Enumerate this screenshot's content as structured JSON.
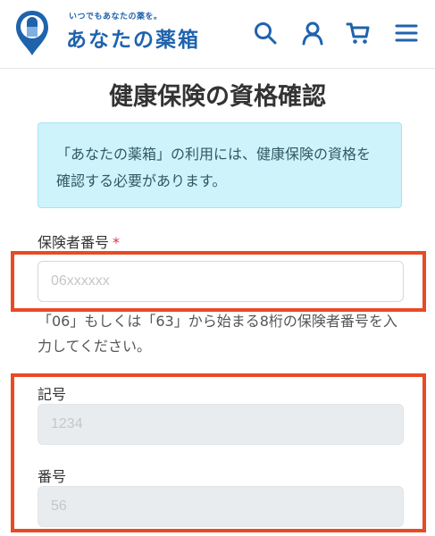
{
  "header": {
    "tagline": "いつでもあなたの薬を。",
    "brand": "あなたの薬箱",
    "icons": [
      "search-icon",
      "user-icon",
      "cart-icon",
      "menu-icon"
    ],
    "brand_color": "#1f63ad"
  },
  "page": {
    "title": "健康保険の資格確認"
  },
  "notice": {
    "text": "「あなたの薬箱」の利用には、健康保険の資格を確認する必要があります。"
  },
  "form": {
    "insurer_number": {
      "label": "保険者番号",
      "required_mark": "*",
      "placeholder": "06xxxxxx",
      "value": ""
    },
    "insurer_help": "「06」もしくは「63」から始まる8桁の保険者番号を入力してください。",
    "symbol": {
      "label": "記号",
      "placeholder": "1234",
      "value": ""
    },
    "number": {
      "label": "番号",
      "placeholder": "56",
      "value": ""
    }
  },
  "highlight_color": "#e84a24"
}
